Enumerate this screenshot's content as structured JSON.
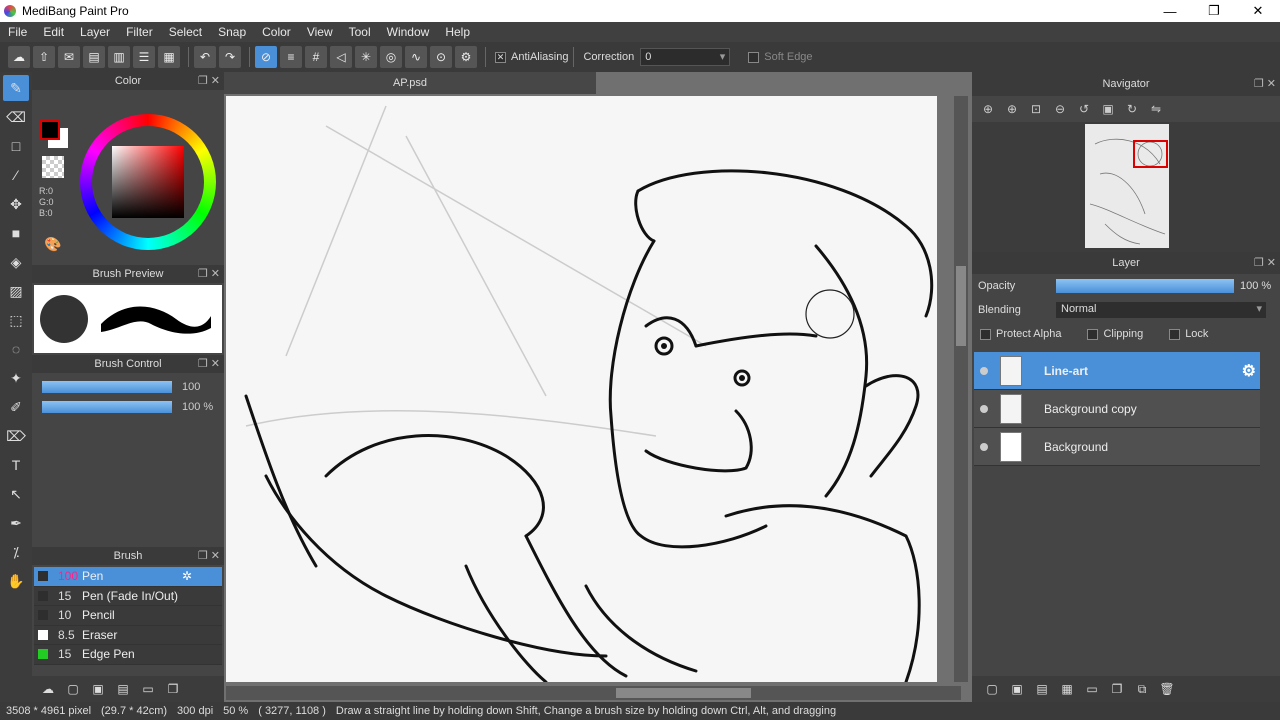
{
  "window": {
    "title": "MediBang Paint Pro",
    "min": "—",
    "restore": "❐",
    "close": "✕"
  },
  "menu": [
    "File",
    "Edit",
    "Layer",
    "Filter",
    "Select",
    "Snap",
    "Color",
    "View",
    "Tool",
    "Window",
    "Help"
  ],
  "toolbar": {
    "antialiasing_label": "AntiAliasing",
    "correction_label": "Correction",
    "correction_value": "0",
    "soft_edge_label": "Soft Edge"
  },
  "color_panel": {
    "title": "Color",
    "r": "R:0",
    "g": "G:0",
    "b": "B:0",
    "fg_color": "#000000",
    "bg_color": "#ffffff"
  },
  "brush_preview": {
    "title": "Brush Preview"
  },
  "brush_control": {
    "title": "Brush Control",
    "size": "100",
    "opacity": "100 %"
  },
  "brush_panel": {
    "title": "Brush",
    "items": [
      {
        "size": "100",
        "name": "Pen",
        "color": "#2e2e2e"
      },
      {
        "size": "15",
        "name": "Pen (Fade In/Out)",
        "color": "#2e2e2e"
      },
      {
        "size": "10",
        "name": "Pencil",
        "color": "#2e2e2e"
      },
      {
        "size": "8.5",
        "name": "Eraser",
        "color": "#ffffff"
      },
      {
        "size": "15",
        "name": "Edge Pen",
        "color": "#22cc22"
      }
    ]
  },
  "canvas": {
    "tab": "AP.psd"
  },
  "navigator": {
    "title": "Navigator"
  },
  "layer_panel": {
    "title": "Layer",
    "opacity_label": "Opacity",
    "opacity_value": "100 %",
    "blending_label": "Blending",
    "blending_value": "Normal",
    "protect_alpha": "Protect Alpha",
    "clipping": "Clipping",
    "lock": "Lock",
    "layers": [
      {
        "name": "Line-art"
      },
      {
        "name": "Background copy"
      },
      {
        "name": "Background"
      }
    ]
  },
  "status": {
    "dims": "3508 * 4961 pixel",
    "size": "(29.7 * 42cm)",
    "dpi": "300 dpi",
    "zoom": "50 %",
    "coords": "( 3277, 1108 )",
    "hint": "Draw a straight line by holding down Shift, Change a brush size by holding down Ctrl, Alt, and dragging"
  }
}
